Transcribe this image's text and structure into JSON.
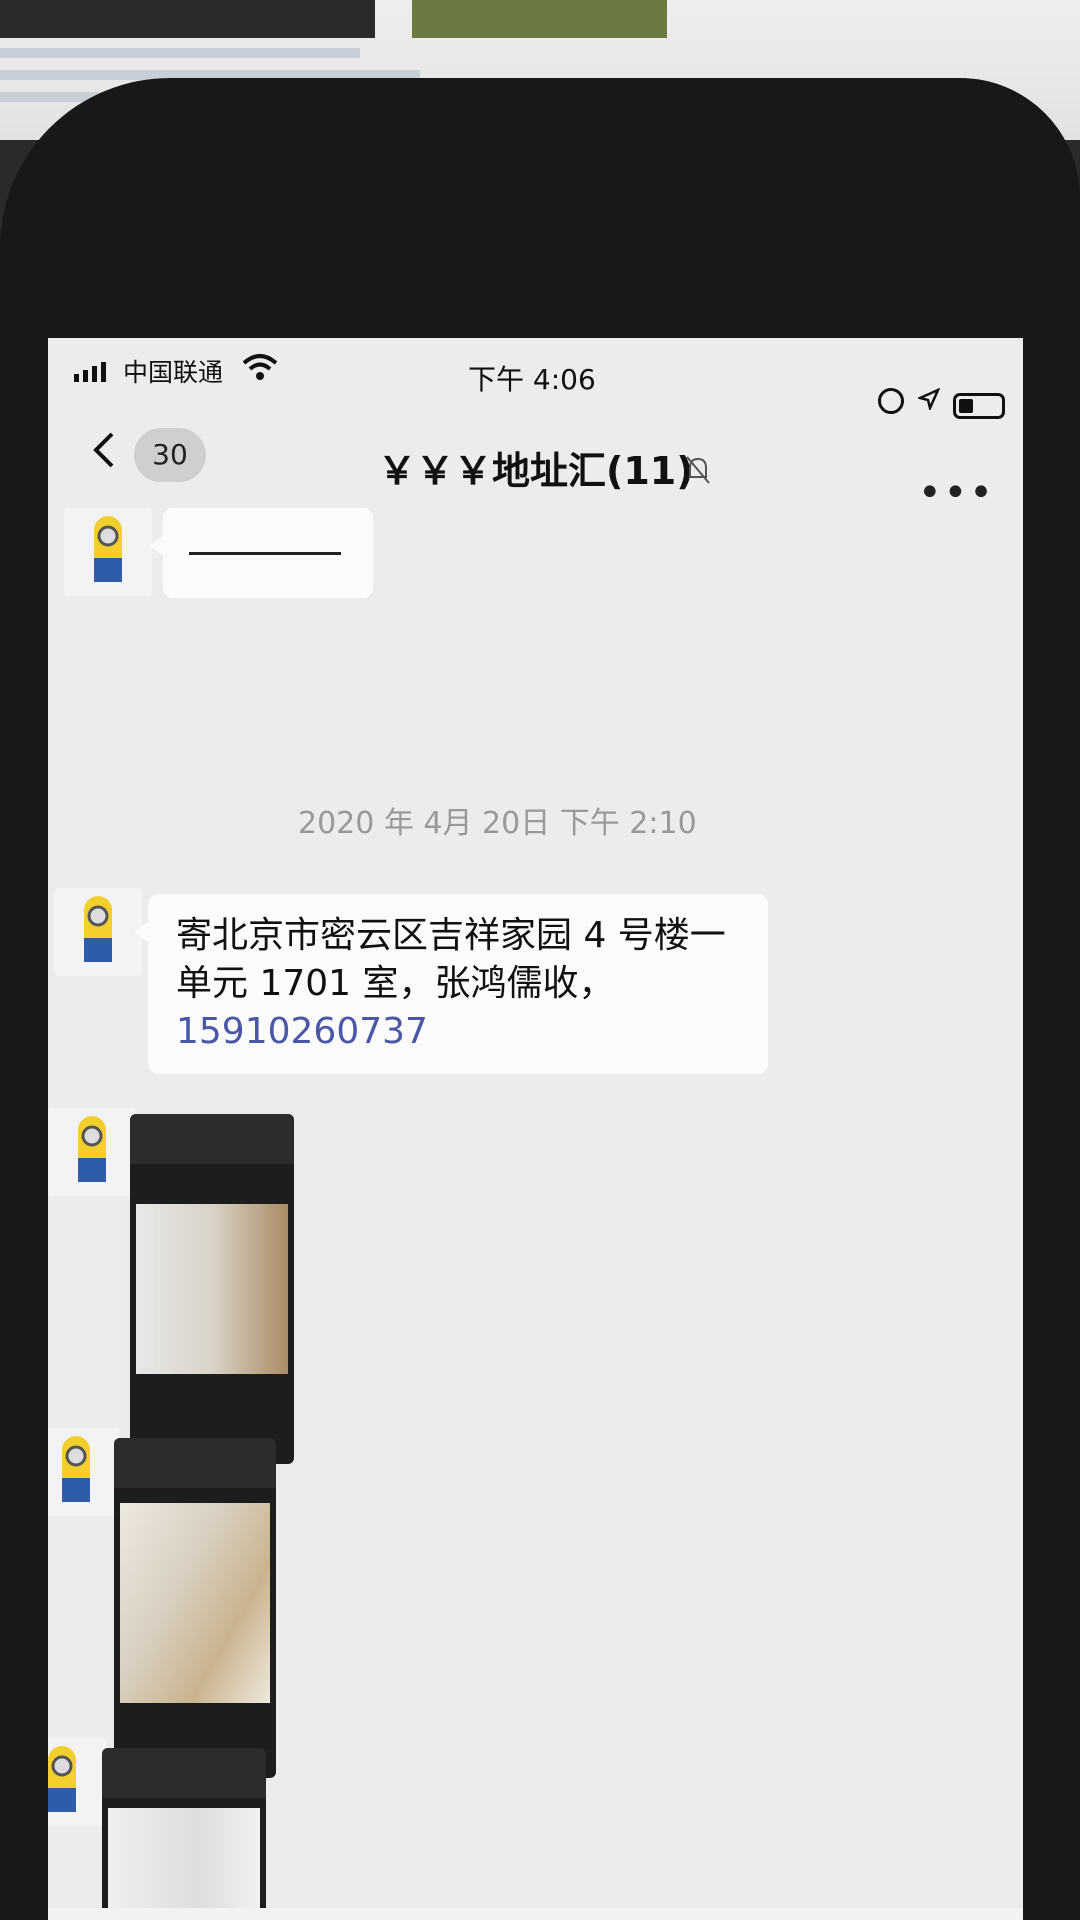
{
  "status_bar": {
    "carrier": "中国联通",
    "time": "下午 4:06"
  },
  "header": {
    "unread_count": "30",
    "chat_title": "￥￥￥地址汇(11)"
  },
  "messages": {
    "timestamp": "2020 年 4月 20日 下午 2:10",
    "address_text": "寄北京市密云区吉祥家园 4 号楼一单元 1701 室，张鸿儒收，",
    "phone_number": "15910260737"
  },
  "colors": {
    "screen_bg": "#ececec",
    "bubble_bg": "#fbfbfb",
    "link": "#4a56a6"
  },
  "icons": [
    "signal-icon",
    "wifi-icon",
    "rotation-lock-icon",
    "location-icon",
    "battery-icon",
    "back-icon",
    "mute-bell-icon",
    "more-icon",
    "avatar-minion-icon",
    "voice-icon"
  ]
}
